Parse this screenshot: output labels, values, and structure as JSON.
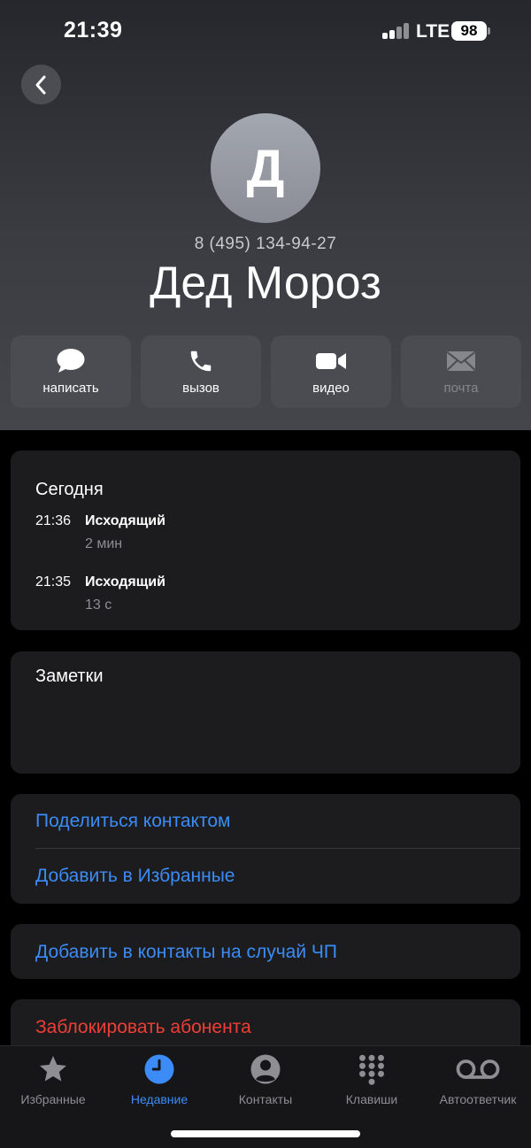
{
  "status_bar": {
    "time": "21:39",
    "network": "LTE",
    "battery": "98"
  },
  "contact": {
    "avatar_letter": "Д",
    "phone": "8 (495) 134-94-27",
    "name": "Дед Мороз"
  },
  "actions": [
    {
      "label": "написать",
      "icon": "message-icon",
      "enabled": true
    },
    {
      "label": "вызов",
      "icon": "phone-icon",
      "enabled": true
    },
    {
      "label": "видео",
      "icon": "video-icon",
      "enabled": true
    },
    {
      "label": "почта",
      "icon": "mail-icon",
      "enabled": false
    }
  ],
  "recents": {
    "title": "Сегодня",
    "calls": [
      {
        "time": "21:36",
        "type": "Исходящий",
        "duration": "2 мин"
      },
      {
        "time": "21:35",
        "type": "Исходящий",
        "duration": "13 с"
      }
    ]
  },
  "notes": {
    "title": "Заметки"
  },
  "options": {
    "share": "Поделиться контактом",
    "favorites": "Добавить в Избранные",
    "emergency": "Добавить в контакты на случай ЧП",
    "block": "Заблокировать абонента"
  },
  "tabs": [
    {
      "label": "Избранные",
      "icon": "star-icon",
      "active": false
    },
    {
      "label": "Недавние",
      "icon": "clock-icon",
      "active": true
    },
    {
      "label": "Контакты",
      "icon": "person-icon",
      "active": false
    },
    {
      "label": "Клавиши",
      "icon": "keypad-icon",
      "active": false
    },
    {
      "label": "Автоответчик",
      "icon": "voicemail-icon",
      "active": false
    }
  ],
  "colors": {
    "accent": "#3b8cf6",
    "destructive": "#ef3e36",
    "card": "#1c1c1e"
  }
}
